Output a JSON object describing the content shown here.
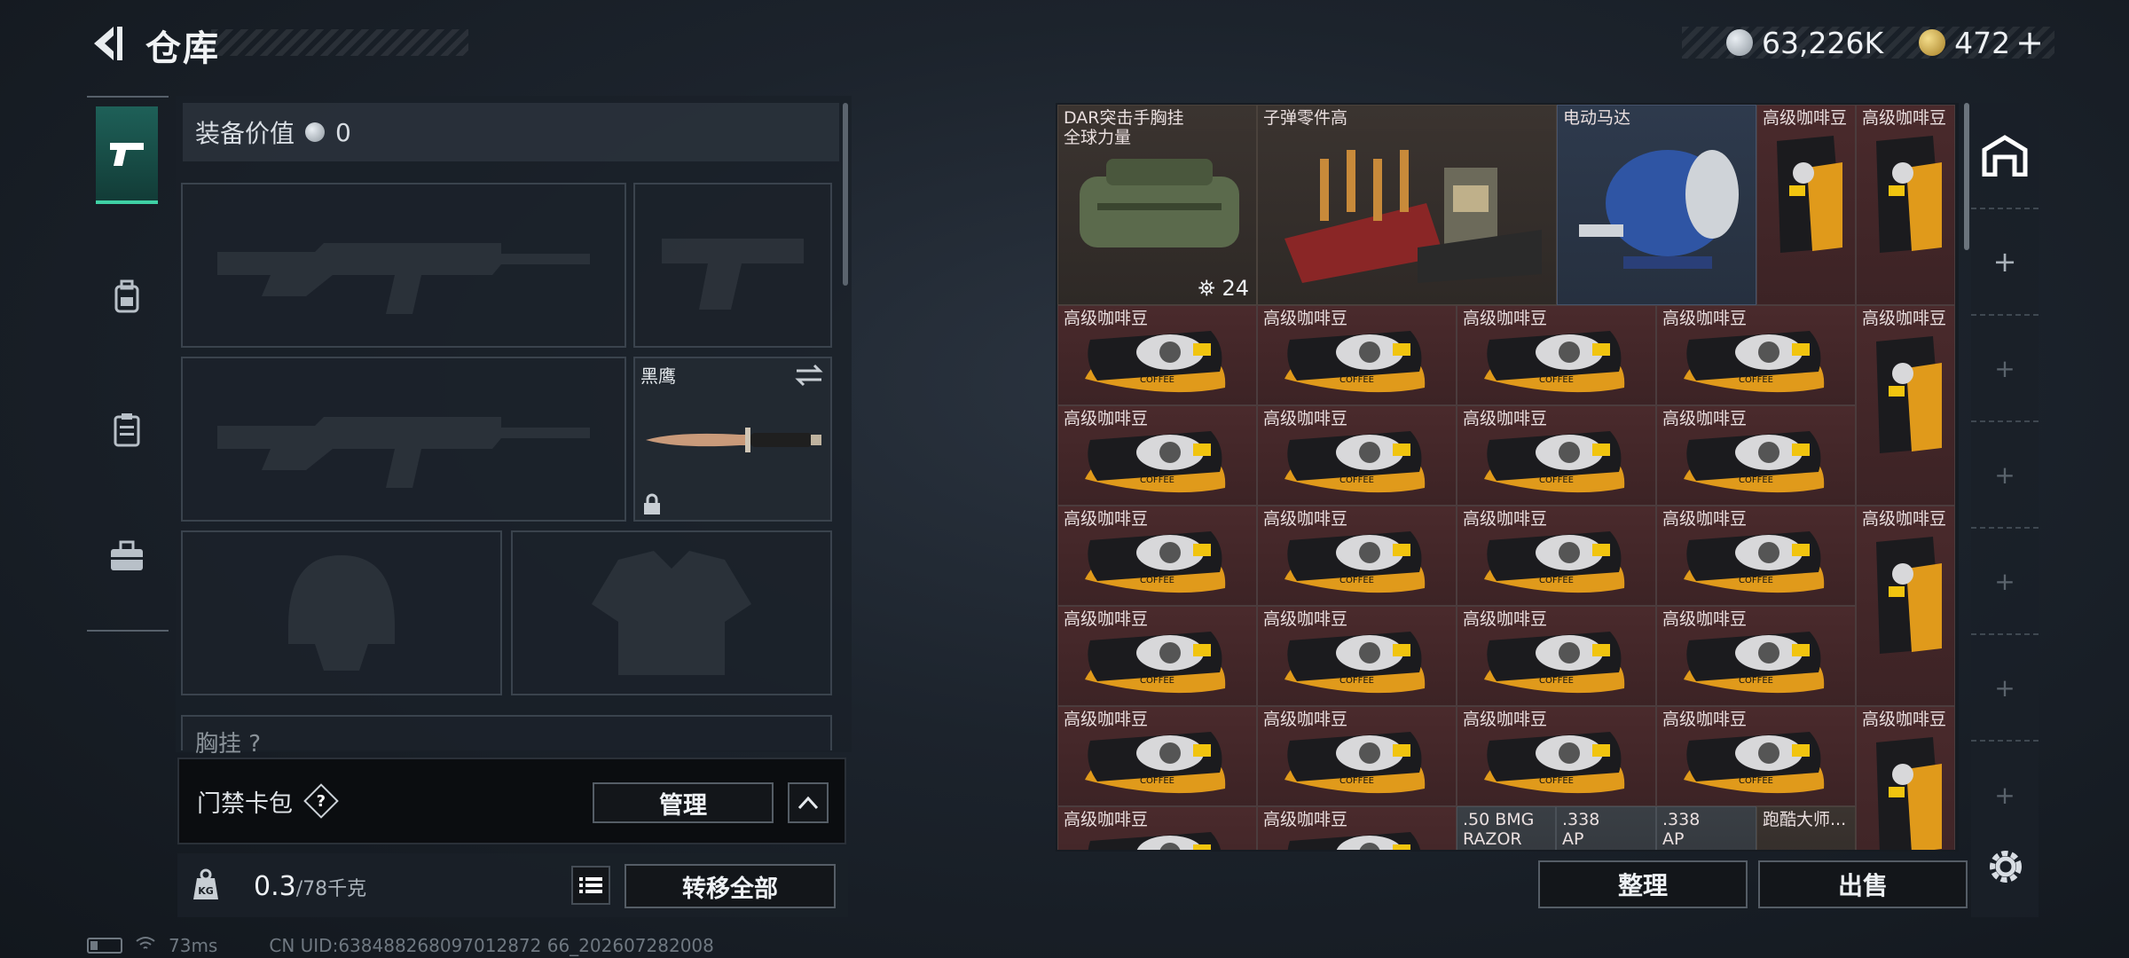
{
  "header": {
    "title": "仓库",
    "coin_silver": "63,226K",
    "coin_gold": "472",
    "add_label": "+"
  },
  "loadout": {
    "equip_value_label": "装备价值",
    "equip_value": "0",
    "knife_name": "黑鹰",
    "chest_label": "胸挂",
    "chest_help": "?"
  },
  "card_pack": {
    "label": "门禁卡包",
    "help": "?",
    "manage_label": "管理"
  },
  "weight": {
    "current": "0.3",
    "max": "/78千克"
  },
  "actions": {
    "transfer_all": "转移全部",
    "sort": "整理",
    "sell": "出售"
  },
  "stash": {
    "top_items": [
      {
        "name": "DAR突击手胸挂\n全球力量",
        "count": "24"
      },
      {
        "name": "子弹零件高"
      },
      {
        "name": "电动马达"
      },
      {
        "name": "高级咖啡豆"
      },
      {
        "name": "高级咖啡豆"
      }
    ],
    "coffee_name": "高级咖啡豆",
    "bottom_row": [
      "高级咖啡豆",
      "高级咖啡豆",
      ".50 BMG\nRAZOR",
      ".338\nAP",
      ".338\nAP",
      "跑酷大师..."
    ]
  },
  "status": {
    "ping": "73ms",
    "uid": "CN UID:638488268097012872 66_202607282008"
  },
  "colors": {
    "accent": "#3fd1a4",
    "item_red": "#4a2a2c"
  }
}
